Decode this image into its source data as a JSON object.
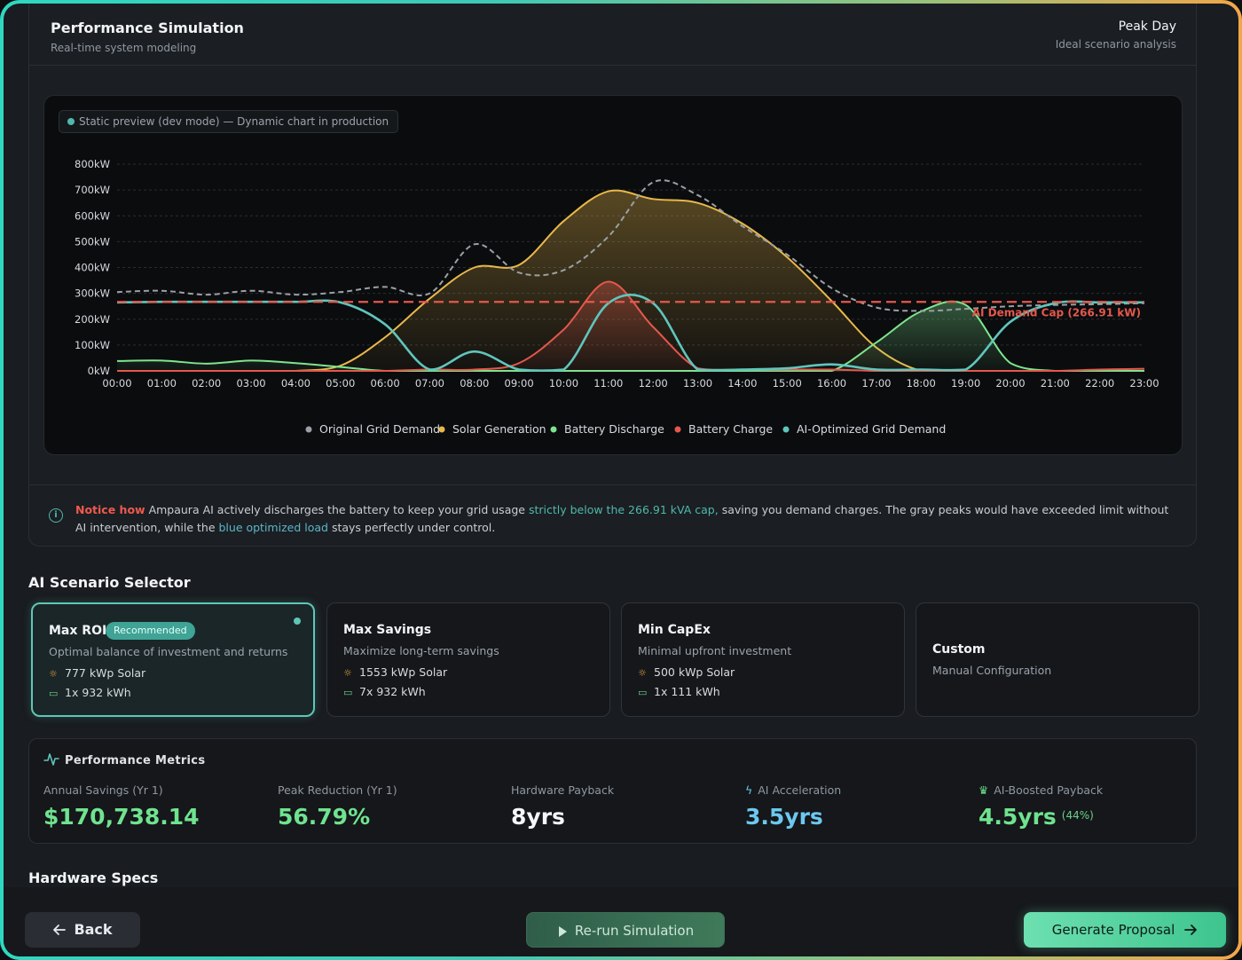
{
  "header": {
    "title": "Performance Simulation",
    "subtitle": "Real-time system modeling",
    "scenario_title": "Peak Day",
    "scenario_subtitle": "Ideal scenario analysis"
  },
  "dev_badge": "Static preview (dev mode) — Dynamic chart in production",
  "chart_data": {
    "type": "area",
    "title": "",
    "xlabel": "",
    "ylabel": "",
    "x": [
      "00:00",
      "01:00",
      "02:00",
      "03:00",
      "04:00",
      "05:00",
      "06:00",
      "07:00",
      "08:00",
      "09:00",
      "10:00",
      "11:00",
      "12:00",
      "13:00",
      "14:00",
      "15:00",
      "16:00",
      "17:00",
      "18:00",
      "19:00",
      "20:00",
      "21:00",
      "22:00",
      "23:00"
    ],
    "y_ticks": [
      "0kW",
      "100kW",
      "200kW",
      "300kW",
      "400kW",
      "500kW",
      "600kW",
      "700kW",
      "800kW"
    ],
    "ylim": [
      0,
      800
    ],
    "grid": true,
    "legend_position": "bottom",
    "series": [
      {
        "name": "Original Grid Demand",
        "color": "#9aa0a6",
        "style": "dashed",
        "values": [
          305,
          310,
          295,
          310,
          295,
          305,
          325,
          300,
          490,
          380,
          390,
          520,
          730,
          680,
          560,
          450,
          320,
          245,
          232,
          240,
          250,
          255,
          258,
          262
        ]
      },
      {
        "name": "Solar Generation",
        "color": "#e8b84a",
        "style": "area",
        "values": [
          0,
          0,
          0,
          0,
          0,
          20,
          130,
          280,
          400,
          410,
          580,
          695,
          665,
          650,
          570,
          440,
          270,
          90,
          0,
          0,
          0,
          0,
          0,
          0
        ]
      },
      {
        "name": "Battery Discharge",
        "color": "#7ee58f",
        "style": "area",
        "values": [
          38,
          40,
          28,
          40,
          30,
          15,
          0,
          0,
          0,
          0,
          0,
          0,
          0,
          0,
          0,
          0,
          0,
          110,
          230,
          255,
          30,
          0,
          0,
          0
        ]
      },
      {
        "name": "Battery Charge",
        "color": "#e5584c",
        "style": "area",
        "values": [
          0,
          0,
          0,
          0,
          0,
          0,
          0,
          5,
          5,
          30,
          160,
          345,
          170,
          10,
          5,
          5,
          5,
          0,
          0,
          0,
          0,
          0,
          5,
          8
        ]
      },
      {
        "name": "AI-Optimized Grid Demand",
        "color": "#5fc6bd",
        "style": "line",
        "values": [
          265,
          267,
          267,
          267,
          267,
          265,
          180,
          5,
          75,
          5,
          5,
          262,
          262,
          5,
          5,
          10,
          25,
          5,
          5,
          5,
          190,
          262,
          265,
          265
        ]
      }
    ],
    "cap": {
      "value": 266.91,
      "label": "AI Demand Cap (266.91 kW)",
      "color": "#e5584c"
    }
  },
  "notice": {
    "lead": "Notice how",
    "part1": " Ampaura AI actively discharges the battery to keep your grid usage ",
    "highlight1": "strictly below the 266.91 kVA cap,",
    "part2": " saving you demand charges. The gray peaks would have exceeded limit without AI intervention, while the ",
    "highlight2": "blue optimized load",
    "part3": " stays perfectly under control."
  },
  "scenario_section_title": "AI Scenario Selector",
  "scenarios": [
    {
      "name": "Max ROI",
      "badge": "Recommended",
      "desc": "Optimal balance of investment and returns",
      "solar": "777 kWp Solar",
      "battery": "1x 932 kWh"
    },
    {
      "name": "Max Savings",
      "desc": "Maximize long-term savings",
      "solar": "1553 kWp Solar",
      "battery": "7x 932 kWh"
    },
    {
      "name": "Min CapEx",
      "desc": "Minimal upfront investment",
      "solar": "500 kWp Solar",
      "battery": "1x 111 kWh"
    },
    {
      "name": "Custom",
      "desc": "Manual Configuration"
    }
  ],
  "metrics": {
    "title": "Performance Metrics",
    "items": [
      {
        "label": "Annual Savings (Yr 1)",
        "value": "$170,738.14"
      },
      {
        "label": "Peak Reduction (Yr 1)",
        "value": "56.79%"
      },
      {
        "label": "Hardware Payback",
        "value": "8yrs"
      },
      {
        "label": "AI Acceleration",
        "value": "3.5yrs"
      },
      {
        "label": "AI-Boosted Payback",
        "value": "4.5yrs",
        "extra": "(44%)"
      }
    ]
  },
  "hardware_section_title": "Hardware Specs",
  "footer": {
    "back": "Back",
    "rerun": "Re-run Simulation",
    "generate": "Generate Proposal"
  }
}
